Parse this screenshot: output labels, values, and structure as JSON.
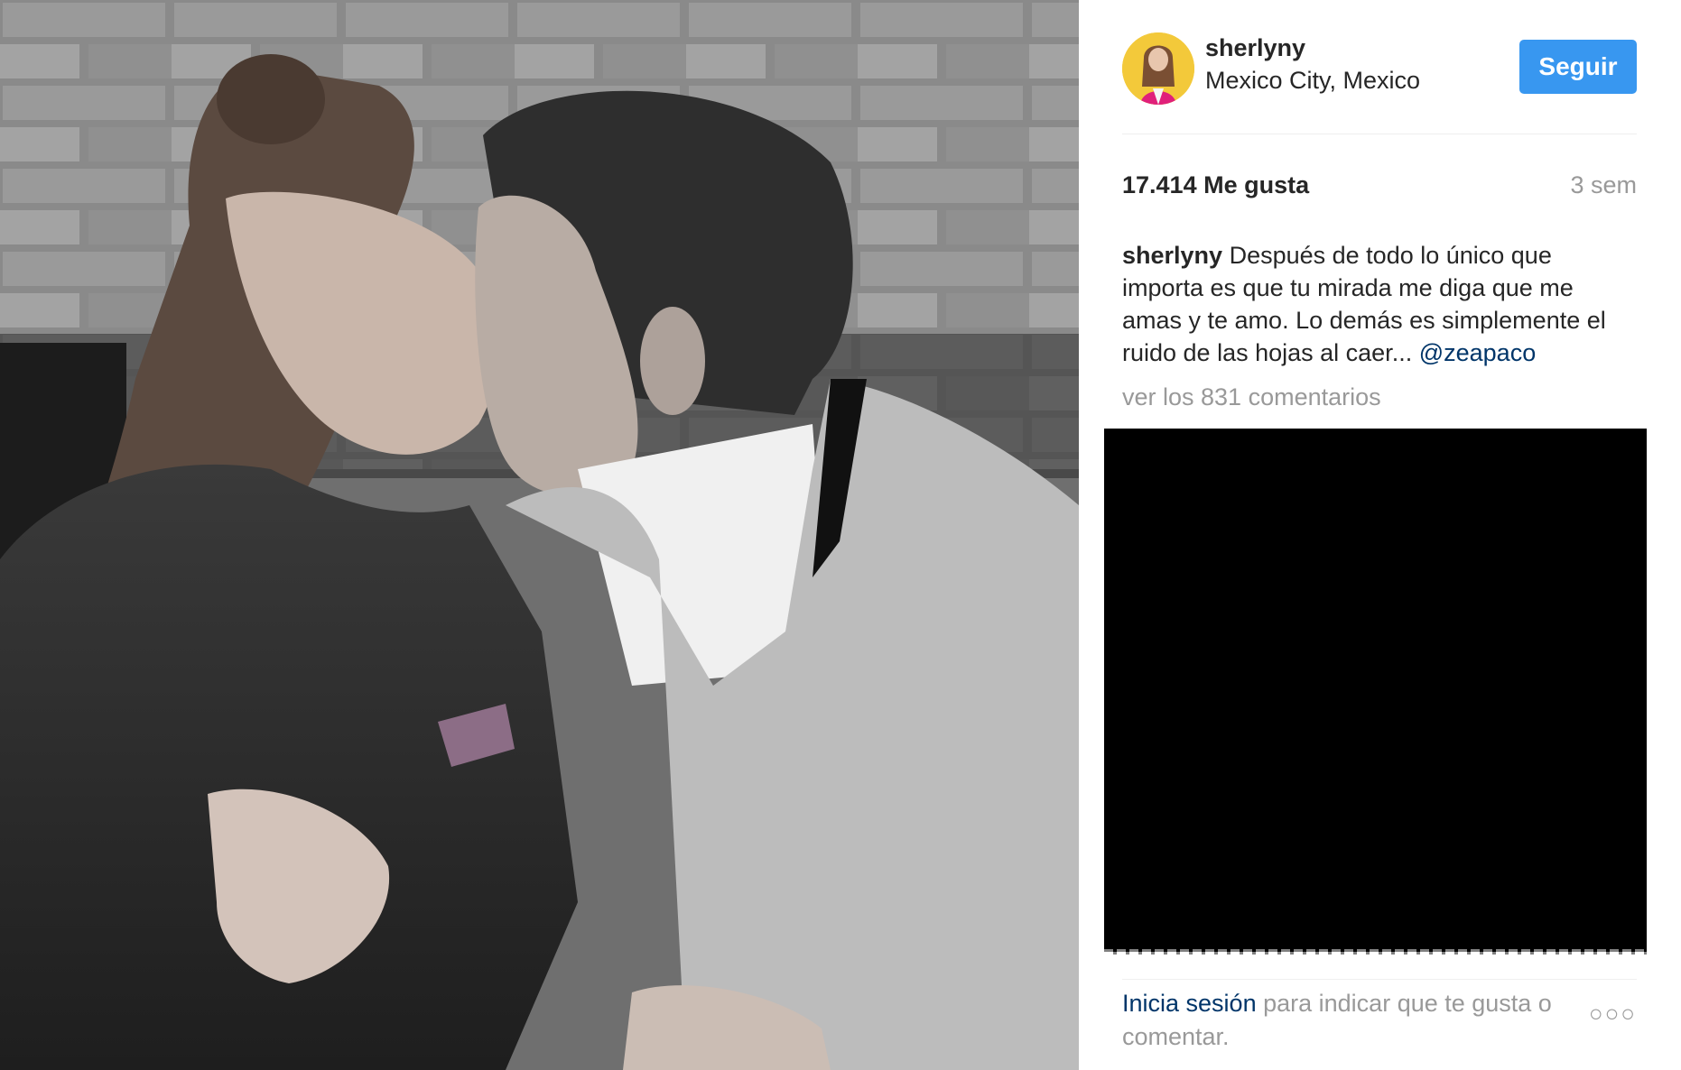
{
  "post": {
    "username": "sherlyny",
    "location": "Mexico City, Mexico",
    "follow_label": "Seguir",
    "likes": "17.414 Me gusta",
    "time_ago": "3 sem",
    "caption_author": "sherlyny",
    "caption_text": "Después de todo lo único que importa es que tu mirada me diga que me amas y te amo. Lo demás es simplemente el ruido de las hojas al caer...",
    "caption_mention": "@zeapaco",
    "view_comments": "ver los 831 comentarios",
    "footer_login": "Inicia sesión",
    "footer_rest": "para indicar que te gusta o comentar.",
    "more_options": "○○○"
  },
  "colors": {
    "follow_button": "#3897f0",
    "link": "#003569",
    "muted_text": "#999999",
    "avatar_background": "#f3c93a"
  }
}
